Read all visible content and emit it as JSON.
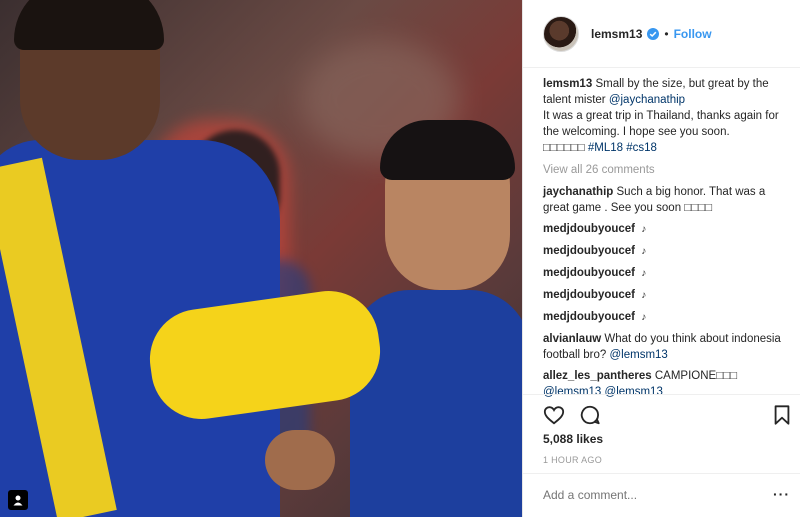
{
  "post": {
    "username": "lemsm13",
    "follow_label": "Follow",
    "separator": "•",
    "likes": "5,088 likes",
    "time": "1 HOUR AGO",
    "add_comment_placeholder": "Add a comment...",
    "more_label": "···"
  },
  "caption": {
    "user": "lemsm13",
    "text_1": "Small by the size, but great by the talent mister ",
    "mention": "@jaychanathip",
    "text_2": "It was a great trip in Thailand, thanks again for the welcoming. I hope see you soon.",
    "emoji": "□□□□□□",
    "tag_1": "#ML18",
    "tag_2": "#cs18"
  },
  "view_all": "View all 26 comments",
  "comments": [
    {
      "user": "jaychanathip",
      "text": "Such a big honor. That was a great game . See you soon □□□□"
    },
    {
      "user": "medjdoubyoucef",
      "text": "♪"
    },
    {
      "user": "medjdoubyoucef",
      "text": "♪"
    },
    {
      "user": "medjdoubyoucef",
      "text": "♪"
    },
    {
      "user": "medjdoubyoucef",
      "text": "♪"
    },
    {
      "user": "medjdoubyoucef",
      "text": "♪"
    },
    {
      "user": "alvianlauw",
      "text": "What do you think about indonesia football bro? ",
      "mention": "@lemsm13"
    },
    {
      "user": "allez_les_pantheres",
      "text": "CAMPIONE□□□ ",
      "mention": "@lemsm13 @lemsm13"
    }
  ],
  "colors": {
    "link": "#003569",
    "follow": "#3897f0",
    "verified": "#3897f0"
  }
}
